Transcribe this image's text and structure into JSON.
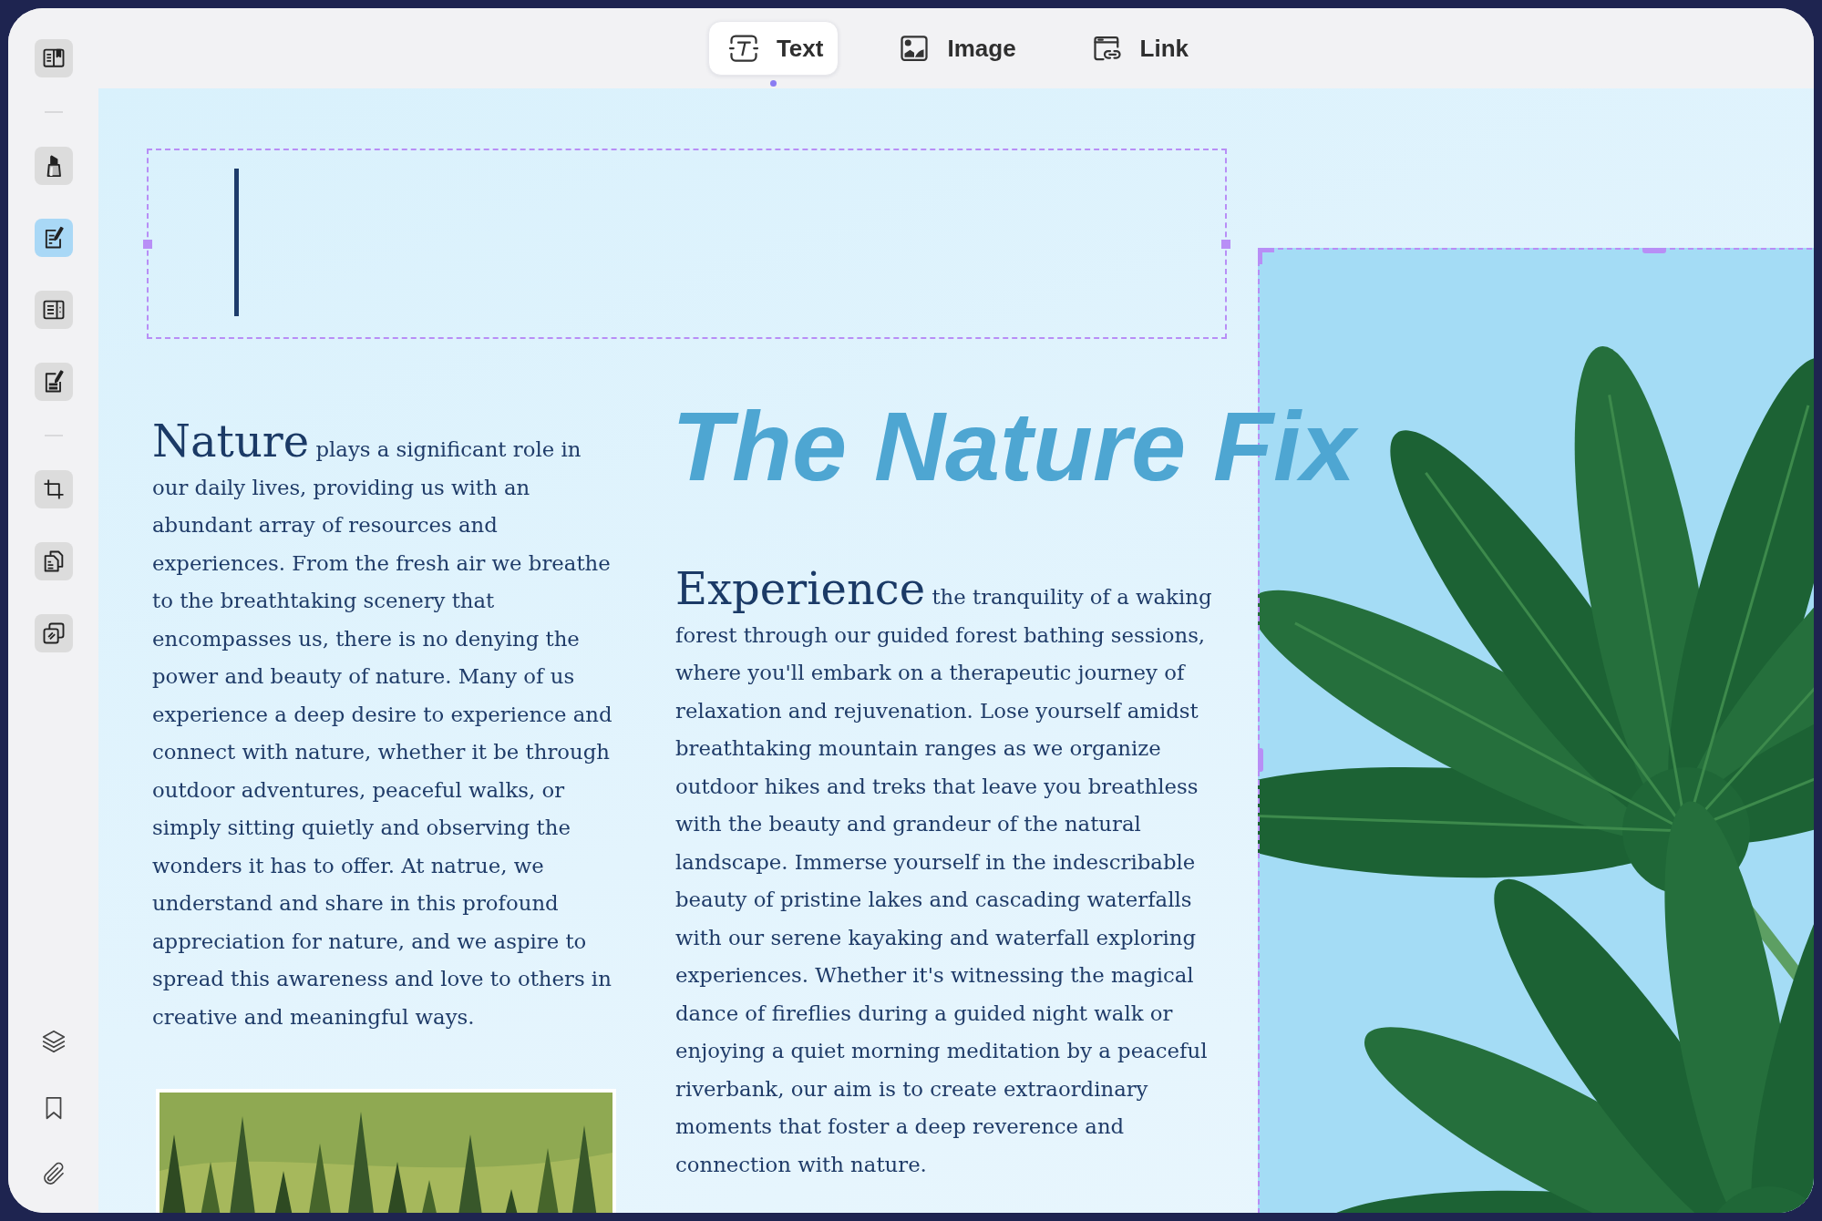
{
  "toolbar": {
    "tabs": [
      {
        "label": "Text",
        "selected": true
      },
      {
        "label": "Image",
        "selected": false
      },
      {
        "label": "Link",
        "selected": false
      }
    ]
  },
  "sidebar": {
    "tool_groups": [
      [
        {
          "selected": false
        }
      ],
      [
        {
          "selected": false
        },
        {
          "selected": true
        },
        {
          "selected": false
        },
        {
          "selected": false
        }
      ],
      [
        {
          "selected": false
        },
        {
          "selected": false
        },
        {
          "selected": false
        }
      ]
    ]
  },
  "text_box": {
    "editing": true
  },
  "sections": [
    {
      "lead": "Nature",
      "body": "plays a significant role in our daily lives, providing us with an abundant array of resources and experiences. From the fresh air we breathe to the breathtaking scenery that encompasses us, there is no denying the power and beauty of nature. Many of us experience a deep desire to experience and connect with nature, whether it be through outdoor adventures, peaceful walks, or simply sitting quietly and observing the wonders it has to offer. At natrue, we understand and share in this profound appreciation for nature, and we aspire to spread this awareness and love to others in creative and meaningful ways."
    },
    {
      "lead": "Experience",
      "body": "the tranquility of a waking forest through our guided forest bathing sessions, where you'll embark on a therapeutic journey of relaxation and rejuvenation. Lose yourself amidst breathtaking mountain ranges as we organize outdoor hikes and treks that leave you breathless with the beauty and grandeur of the natural landscape. Immerse yourself in the indescribable beauty of pristine lakes and cascading waterfalls with our serene kayaking and waterfall exploring experiences. Whether it's witnessing the magical dance of fireflies during a guided night walk or enjoying a quiet morning meditation by a peaceful riverbank, our aim is to create extraordinary moments that foster a deep reverence and connection with nature."
    }
  ],
  "title": "The Nature Fix",
  "image": {
    "selected": true
  }
}
